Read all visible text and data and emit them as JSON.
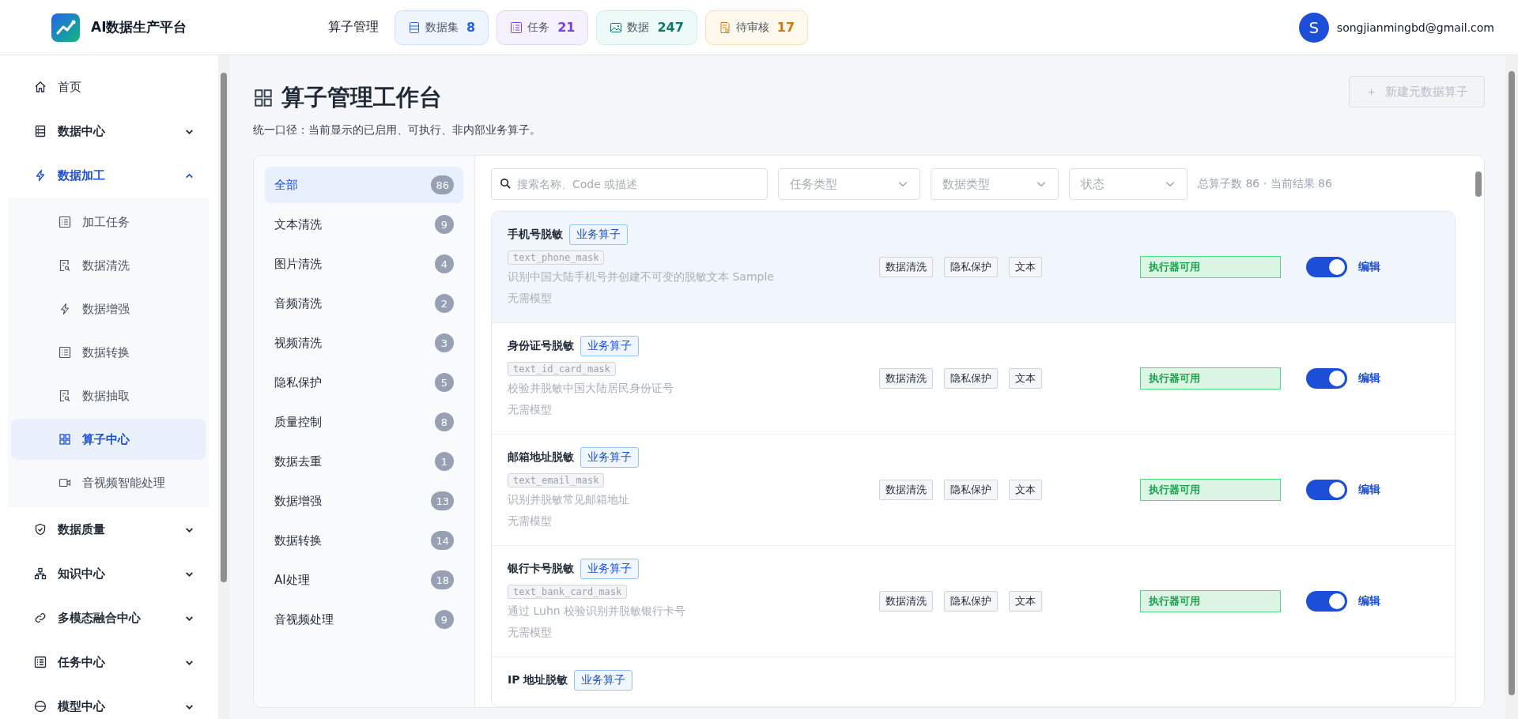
{
  "app": {
    "title": "AI数据生产平台"
  },
  "header": {
    "page": "算子管理",
    "stats": [
      {
        "kind": "dataset",
        "label": "数据集",
        "count": "8",
        "color": "#2563eb"
      },
      {
        "kind": "task",
        "label": "任务",
        "count": "21",
        "color": "#7c3aed"
      },
      {
        "kind": "data",
        "label": "数据",
        "count": "247",
        "color": "#0f766e"
      },
      {
        "kind": "review",
        "label": "待审核",
        "count": "17",
        "color": "#d97706"
      }
    ],
    "user": {
      "initial": "S",
      "email": "songjianmingbd@gmail.com"
    }
  },
  "sidebar": {
    "items": [
      {
        "kind": "home",
        "label": "首页",
        "selected": false
      },
      {
        "kind": "db",
        "label": "数据中心",
        "expanded": false,
        "selected": false
      },
      {
        "kind": "bolt",
        "label": "数据加工",
        "expanded": true,
        "selected": true,
        "children": [
          {
            "kind": "list",
            "label": "加工任务",
            "selected": false
          },
          {
            "kind": "doc",
            "label": "数据清洗",
            "selected": false
          },
          {
            "kind": "bolt",
            "label": "数据增强",
            "selected": false
          },
          {
            "kind": "list",
            "label": "数据转换",
            "selected": false
          },
          {
            "kind": "doc",
            "label": "数据抽取",
            "selected": false
          },
          {
            "kind": "grid",
            "label": "算子中心",
            "selected": true
          },
          {
            "kind": "video",
            "label": "音视频智能处理",
            "selected": false
          }
        ]
      },
      {
        "kind": "shield",
        "label": "数据质量",
        "expanded": false,
        "selected": false
      },
      {
        "kind": "tree",
        "label": "知识中心",
        "expanded": false,
        "selected": false
      },
      {
        "kind": "link",
        "label": "多模态融合中心",
        "expanded": false,
        "selected": false
      },
      {
        "kind": "list",
        "label": "任务中心",
        "expanded": false,
        "selected": false
      },
      {
        "kind": "globe",
        "label": "模型中心",
        "expanded": false,
        "selected": false
      }
    ]
  },
  "page": {
    "title": "算子管理工作台",
    "subtitle": "统一口径：当前显示的已启用、可执行、非内部业务算子。",
    "create_button": {
      "icon": "＋",
      "label": "新建元数据算子",
      "disabled": true
    }
  },
  "categories": [
    {
      "label": "全部",
      "count": "86",
      "selected": true
    },
    {
      "label": "文本清洗",
      "count": "9",
      "selected": false
    },
    {
      "label": "图片清洗",
      "count": "4",
      "selected": false
    },
    {
      "label": "音频清洗",
      "count": "2",
      "selected": false
    },
    {
      "label": "视频清洗",
      "count": "3",
      "selected": false
    },
    {
      "label": "隐私保护",
      "count": "5",
      "selected": false
    },
    {
      "label": "质量控制",
      "count": "8",
      "selected": false
    },
    {
      "label": "数据去重",
      "count": "1",
      "selected": false
    },
    {
      "label": "数据增强",
      "count": "13",
      "selected": false
    },
    {
      "label": "数据转换",
      "count": "14",
      "selected": false
    },
    {
      "label": "AI处理",
      "count": "18",
      "selected": false
    },
    {
      "label": "音视频处理",
      "count": "9",
      "selected": false
    }
  ],
  "filters": {
    "search": {
      "placeholder": "搜索名称、Code 或描述"
    },
    "selects": [
      {
        "placeholder": "任务类型"
      },
      {
        "placeholder": "数据类型"
      },
      {
        "placeholder": "状态"
      }
    ],
    "summary": "总算子数 86 · 当前结果 86"
  },
  "operators": [
    {
      "name": "手机号脱敏",
      "badge": "业务算子",
      "code": "text_phone_mask",
      "description": "识别中国大陆手机号并创建不可变的脱敏文本 Sample",
      "model": "无需模型",
      "tags": [
        "数据清洗",
        "隐私保护",
        "文本"
      ],
      "status": "执行器可用",
      "enabled": true,
      "action": "编辑",
      "highlighted": true
    },
    {
      "name": "身份证号脱敏",
      "badge": "业务算子",
      "code": "text_id_card_mask",
      "description": "校验并脱敏中国大陆居民身份证号",
      "model": "无需模型",
      "tags": [
        "数据清洗",
        "隐私保护",
        "文本"
      ],
      "status": "执行器可用",
      "enabled": true,
      "action": "编辑",
      "highlighted": false
    },
    {
      "name": "邮箱地址脱敏",
      "badge": "业务算子",
      "code": "text_email_mask",
      "description": "识别并脱敏常见邮箱地址",
      "model": "无需模型",
      "tags": [
        "数据清洗",
        "隐私保护",
        "文本"
      ],
      "status": "执行器可用",
      "enabled": true,
      "action": "编辑",
      "highlighted": false
    },
    {
      "name": "银行卡号脱敏",
      "badge": "业务算子",
      "code": "text_bank_card_mask",
      "description": "通过 Luhn 校验识别并脱敏银行卡号",
      "model": "无需模型",
      "tags": [
        "数据清洗",
        "隐私保护",
        "文本"
      ],
      "status": "执行器可用",
      "enabled": true,
      "action": "编辑",
      "highlighted": false
    },
    {
      "name": "IP 地址脱敏",
      "badge": "业务算子",
      "highlighted": false
    }
  ]
}
